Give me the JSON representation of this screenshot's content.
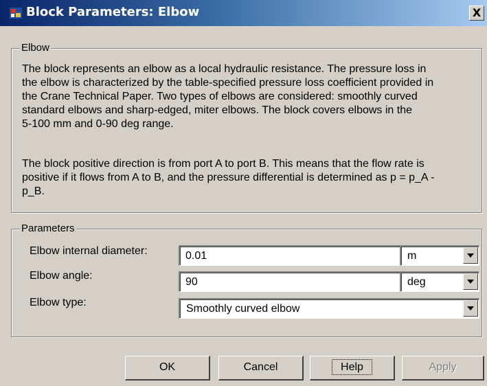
{
  "window": {
    "title": "Block Parameters: Elbow",
    "close_glyph": "X"
  },
  "description_group": {
    "legend": "Elbow",
    "paragraph1_lines": [
      "The block represents an elbow as a local hydraulic resistance. The pressure loss in",
      "the elbow is characterized by the table-specified pressure loss coefficient provided in",
      "the Crane Technical Paper. Two types of elbows are considered: smoothly curved",
      "standard elbows and sharp-edged, miter elbows. The block covers elbows in the",
      "5-100 mm and 0-90 deg range."
    ],
    "paragraph2_lines": [
      "The block positive direction is from port A to port B. This means that the flow rate is",
      "positive if it flows from A to B, and the pressure differential is determined as p = p_A -",
      "p_B."
    ]
  },
  "parameters_group": {
    "legend": "Parameters",
    "diameter": {
      "label": "Elbow internal diameter:",
      "value": "0.01",
      "unit": "m"
    },
    "angle": {
      "label": "Elbow angle:",
      "value": "90",
      "unit": "deg"
    },
    "type": {
      "label": "Elbow type:",
      "value": "Smoothly curved elbow"
    }
  },
  "buttons": {
    "ok": "OK",
    "cancel": "Cancel",
    "help": "Help",
    "apply": "Apply"
  },
  "icons": {
    "title_icon": "simulink-block-icon",
    "close_icon": "close-icon",
    "dropdown_icon": "chevron-down-icon"
  }
}
